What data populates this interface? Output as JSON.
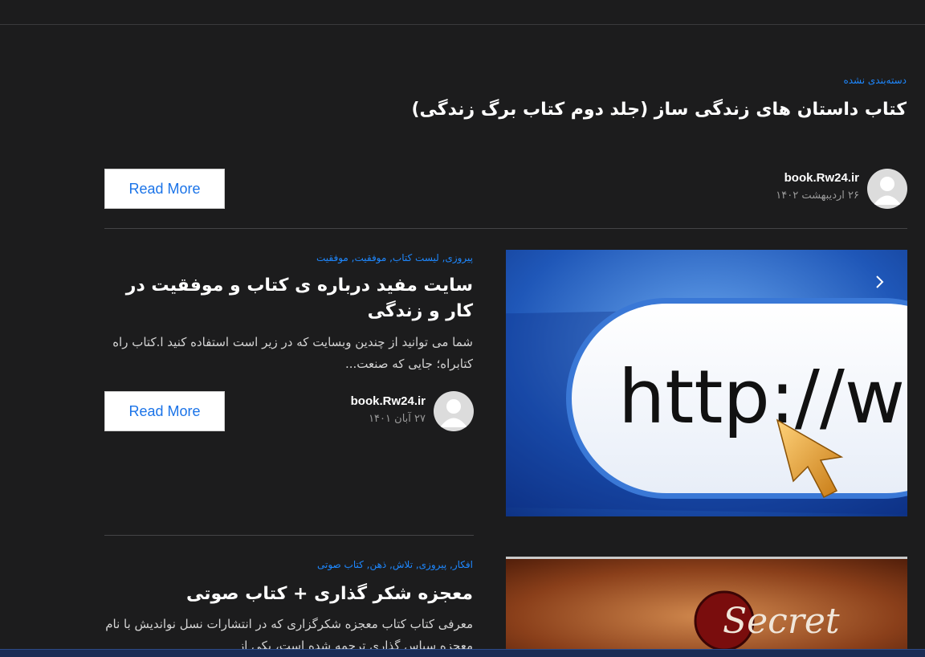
{
  "post1": {
    "categories": "دسته‌بندی نشده",
    "title": "کتاب داستان های زندگی ساز (جلد دوم کتاب برگ زندگی)",
    "author": "book.Rw24.ir",
    "date": "۲۶ اردیبهشت ۱۴۰۲",
    "read_more": "Read More"
  },
  "post2": {
    "categories": "پیروزی, لیست کتاب, موفقیت, موفقیت",
    "title": "سایت مفید درباره ی کتاب و موفقیت در کار و زندگی",
    "excerpt": "شما می توانید از چندین وبسایت که در زیر است استفاده کنید ا.کتاب راه کتابراه؛ جایی که صنعت...",
    "author": "book.Rw24.ir",
    "date": "۲۷ آبان ۱۴۰۱",
    "read_more": "Read More",
    "image_text": "http://www."
  },
  "post3": {
    "categories": "افکار, پیروزی, تلاش, ذهن, کتاب صوتی",
    "title": "معجزه شکر گذاری + کتاب صوتی",
    "excerpt": "معرفی کتاب کتاب معجزه شکرگزاری که در انتشارات نسل نواندیش با نام معجزه سپاس گذاری ترجمه شده است، یکی از",
    "image_text": "Secret"
  },
  "colors": {
    "accent": "#1e88ff",
    "background": "#1c1c1d",
    "button_text": "#1a73e8"
  },
  "icons": {
    "avatar": "user-avatar-icon",
    "arrow": "chevron-left-icon",
    "cursor": "mouse-pointer-icon"
  }
}
